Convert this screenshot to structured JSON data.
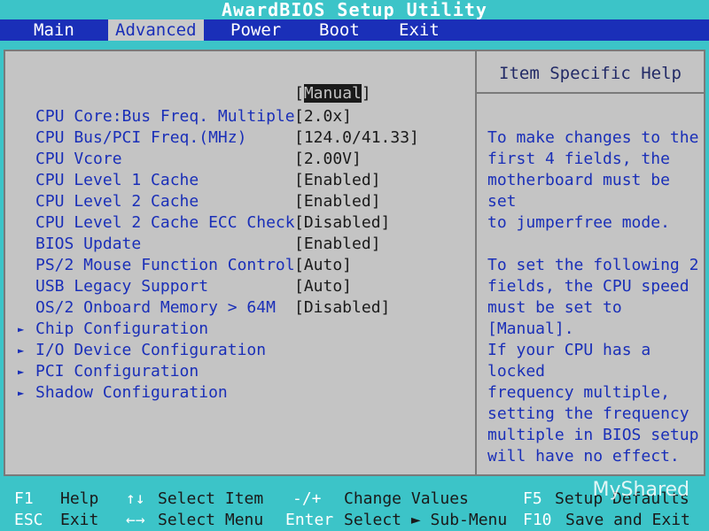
{
  "title": "AwardBIOS Setup Utility",
  "menu": [
    "Main",
    "Advanced",
    "Power",
    "Boot",
    "Exit"
  ],
  "active_menu": "Advanced",
  "top_value": "[Manual]",
  "settings": [
    {
      "label": "CPU Core:Bus Freq. Multiple",
      "value": "[2.0x]"
    },
    {
      "label": "CPU Bus/PCI Freq.(MHz)",
      "value": "[124.0/41.33]"
    },
    {
      "label": "CPU Vcore",
      "value": "[2.00V]"
    },
    {
      "label": "CPU Level 1 Cache",
      "value": "[Enabled]"
    },
    {
      "label": "CPU Level 2 Cache",
      "value": "[Enabled]"
    },
    {
      "label": "CPU Level 2 Cache ECC Check",
      "value": "[Disabled]"
    },
    {
      "label": "BIOS Update",
      "value": "[Enabled]"
    },
    {
      "label": "PS/2 Mouse Function Control",
      "value": "[Auto]"
    },
    {
      "label": "USB Legacy Support",
      "value": "[Auto]"
    },
    {
      "label": "OS/2 Onboard Memory > 64M",
      "value": "[Disabled]"
    }
  ],
  "submenus": [
    "Chip Configuration",
    "I/O Device Configuration",
    "PCI Configuration",
    "Shadow Configuration"
  ],
  "help": {
    "title": "Item Specific Help",
    "para1": "To make changes to the\nfirst 4 fields, the\nmotherboard must be set\nto jumperfree mode.",
    "para2": "To set the following 2\nfields, the CPU speed\nmust be set to [Manual].\nIf your CPU has a locked\nfrequency multiple,\nsetting the frequency\nmultiple in BIOS setup\nwill have no effect."
  },
  "keys": {
    "row1": [
      {
        "key": "F1",
        "desc": "Help"
      },
      {
        "key": "↑↓",
        "desc": "Select Item"
      },
      {
        "key": "-/+",
        "desc": "Change Values"
      },
      {
        "key": "F5",
        "desc": "Setup Defaults"
      }
    ],
    "row2": [
      {
        "key": "ESC",
        "desc": "Exit"
      },
      {
        "key": "←→",
        "desc": "Select Menu"
      },
      {
        "key": "Enter",
        "desc": "Select ► Sub-Menu"
      },
      {
        "key": "F10",
        "desc": "Save and Exit"
      }
    ]
  },
  "watermark": "MyShared"
}
